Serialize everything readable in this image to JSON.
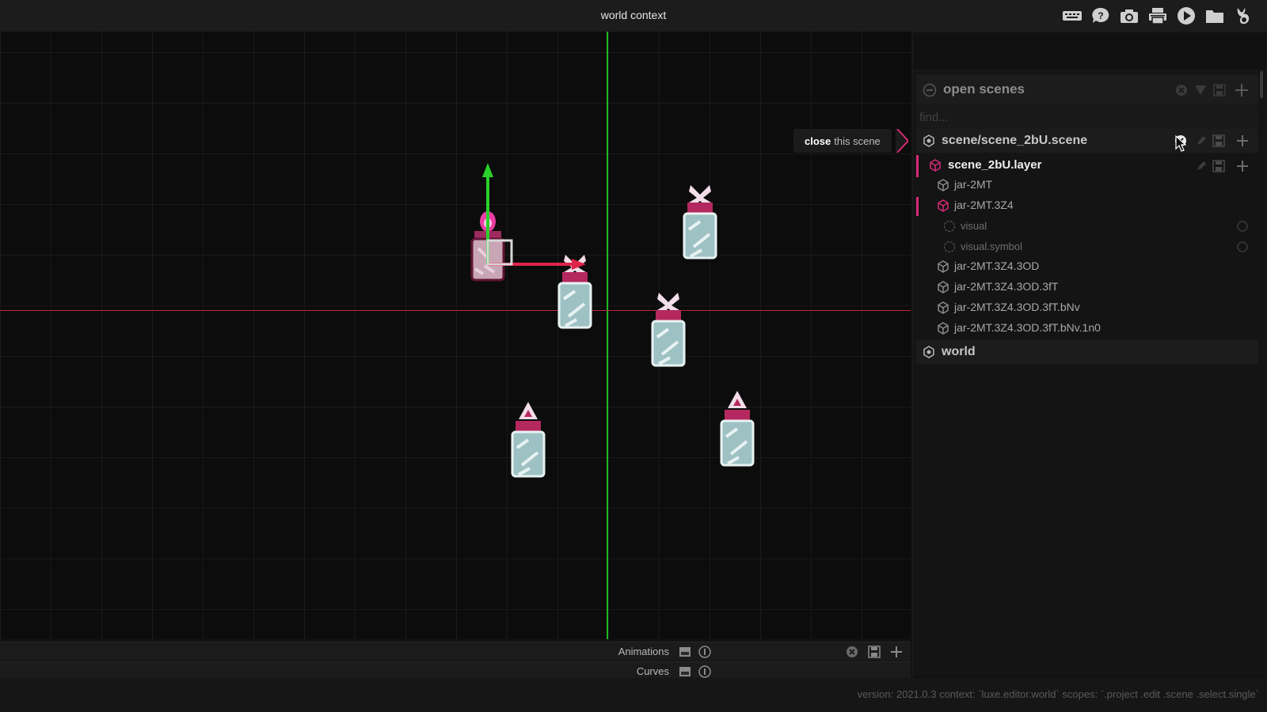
{
  "window": {
    "title": "world context"
  },
  "toolbar": {
    "icons": [
      "keyboard-icon",
      "help-icon",
      "camera-icon",
      "print-icon",
      "play-icon",
      "folder-icon",
      "horns-icon"
    ]
  },
  "tooltip": {
    "bold": "close",
    "text": "this scene"
  },
  "outliner": {
    "section_label": "open scenes",
    "find_placeholder": "find...",
    "scene": {
      "label": "scene/scene_2bU.scene"
    },
    "layer": {
      "label": "scene_2bU.layer"
    },
    "entities": {
      "e0": "jar-2MT",
      "e1": "jar-2MT.3Z4",
      "c0": "visual",
      "c1": "visual.symbol",
      "e2": "jar-2MT.3Z4.3OD",
      "e3": "jar-2MT.3Z4.3OD.3fT",
      "e4": "jar-2MT.3Z4.3OD.3fT.bNv",
      "e5": "jar-2MT.3Z4.3OD.3fT.bNv.1n0"
    },
    "world": {
      "label": "world"
    }
  },
  "bottom": {
    "animations_label": "Animations",
    "curves_label": "Curves"
  },
  "status": {
    "text": "version: 2021.0.3 context: `luxe.editor.world` scopes: `.project .edit .scene .select.single`"
  },
  "colors": {
    "axis_x": "#c2263e",
    "axis_y": "#1fb81f",
    "accent": "#d82a78"
  }
}
